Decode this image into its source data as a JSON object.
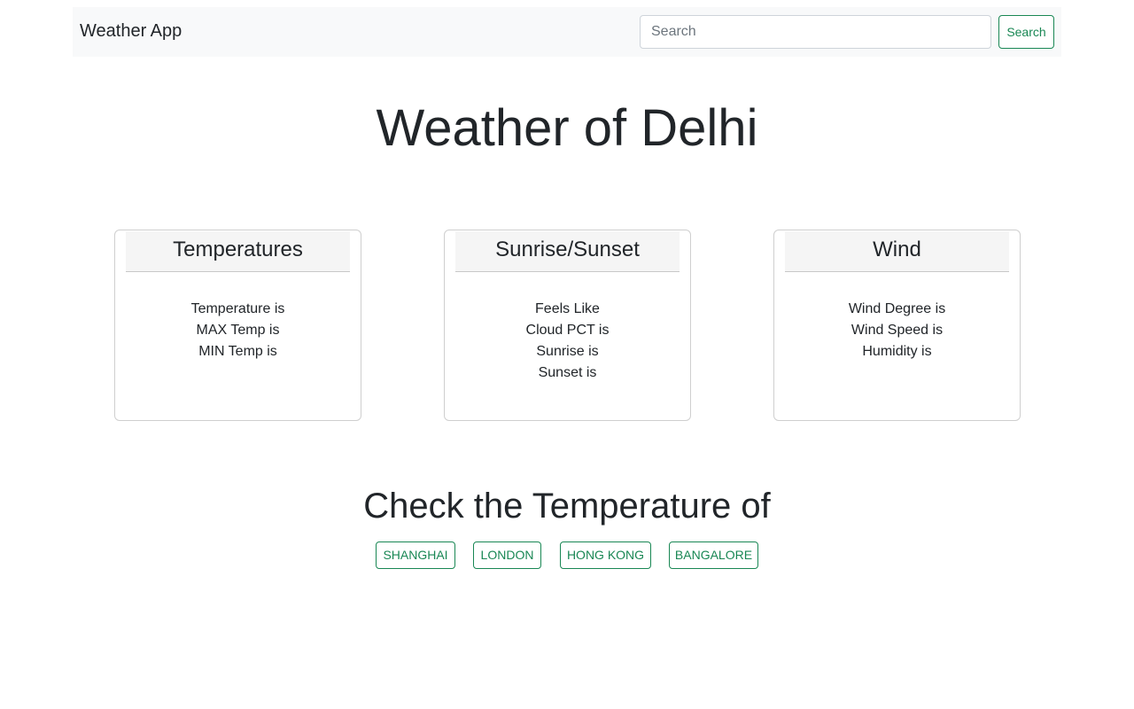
{
  "navbar": {
    "brand": "Weather App",
    "search_placeholder": "Search",
    "search_button": "Search"
  },
  "main": {
    "title": "Weather of Delhi"
  },
  "cards": [
    {
      "header": "Temperatures",
      "lines": [
        "Temperature is",
        "MAX Temp is",
        "MIN Temp is"
      ]
    },
    {
      "header": "Sunrise/Sunset",
      "lines": [
        "Feels Like",
        "Cloud PCT is",
        "Sunrise is",
        "Sunset is"
      ]
    },
    {
      "header": "Wind",
      "lines": [
        "Wind Degree is",
        "Wind Speed is",
        "Humidity is"
      ]
    }
  ],
  "cities": {
    "heading": "Check the Temperature of",
    "buttons": [
      "Shanghai",
      "London",
      "Hong Kong",
      "Bangalore"
    ]
  },
  "colors": {
    "accent": "#198754",
    "navbar_bg": "#f8f9fa",
    "text": "#212529"
  }
}
